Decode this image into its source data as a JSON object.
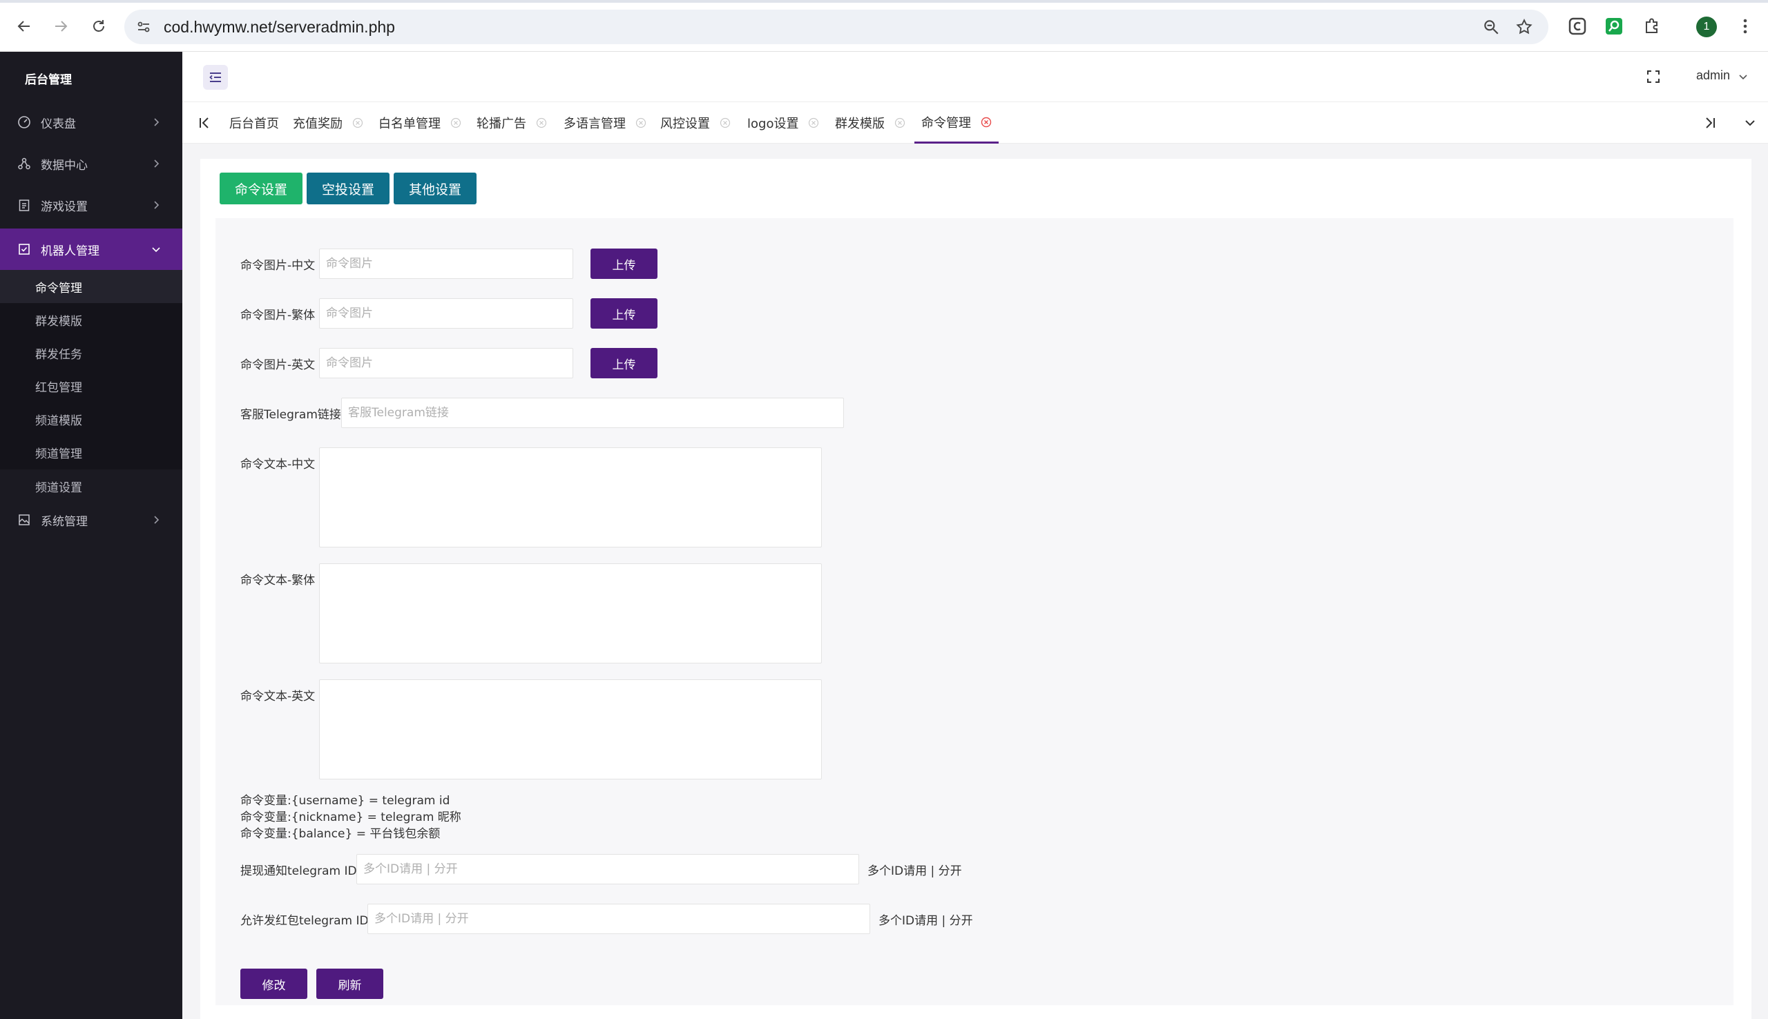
{
  "browser": {
    "url": "cod.hwymw.net/serveradmin.php",
    "profile_initial": "1"
  },
  "sidebar": {
    "brand": "后台管理",
    "menus": [
      {
        "label": "仪表盘",
        "icon": "gauge-icon"
      },
      {
        "label": "数据中心",
        "icon": "hierarchy-icon"
      },
      {
        "label": "游戏设置",
        "icon": "clipboard-icon"
      },
      {
        "label": "机器人管理",
        "icon": "checkbox-icon"
      },
      {
        "label": "系统管理",
        "icon": "image-icon"
      }
    ],
    "robot_submenu": [
      "命令管理",
      "群发模版",
      "群发任务",
      "红包管理",
      "频道模版",
      "频道管理",
      "频道设置"
    ]
  },
  "header": {
    "user": "admin"
  },
  "tabs": [
    "后台首页",
    "充值奖励",
    "白名单管理",
    "轮播广告",
    "多语言管理",
    "风控设置",
    "logo设置",
    "群发模版",
    "命令管理"
  ],
  "content": {
    "top_buttons": [
      "命令设置",
      "空投设置",
      "其他设置"
    ],
    "image_fields": [
      {
        "label": "命令图片-中文",
        "placeholder": "命令图片",
        "button": "上传"
      },
      {
        "label": "命令图片-繁体",
        "placeholder": "命令图片",
        "button": "上传"
      },
      {
        "label": "命令图片-英文",
        "placeholder": "命令图片",
        "button": "上传"
      }
    ],
    "telegram_link": {
      "label": "客服Telegram链接",
      "placeholder": "客服Telegram链接"
    },
    "text_fields": [
      "命令文本-中文",
      "命令文本-繁体",
      "命令文本-英文"
    ],
    "variables": [
      "命令变量:{username} = telegram id",
      "命令变量:{nickname} = telegram 昵称",
      "命令变量:{balance} = 平台钱包余额"
    ],
    "withdraw_notify": {
      "label": "提现通知telegram ID",
      "placeholder": "多个ID请用 | 分开",
      "hint": "多个ID请用 | 分开"
    },
    "redpacket_allow": {
      "label": "允许发红包telegram ID",
      "placeholder": "多个ID请用 | 分开",
      "hint": "多个ID请用 | 分开"
    },
    "actions": [
      "修改",
      "刷新"
    ]
  }
}
